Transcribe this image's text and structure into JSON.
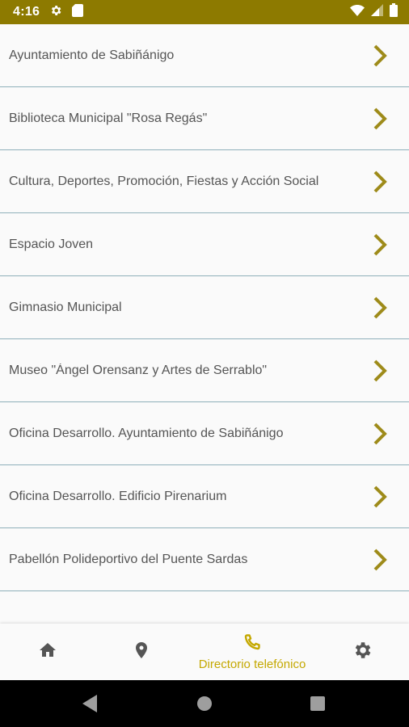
{
  "status_bar": {
    "time": "4:16",
    "icons": [
      "settings-icon",
      "sd-card-icon",
      "wifi-icon",
      "signal-icon",
      "battery-icon"
    ]
  },
  "directory": {
    "items": [
      {
        "label": "Ayuntamiento de Sabiñánigo"
      },
      {
        "label": "Biblioteca Municipal \"Rosa Regás\""
      },
      {
        "label": "Cultura, Deportes, Promoción, Fiestas y Acción Social"
      },
      {
        "label": "Espacio Joven"
      },
      {
        "label": "Gimnasio Municipal"
      },
      {
        "label": "Museo \"Ángel Orensanz y Artes de Serrablo\""
      },
      {
        "label": "Oficina Desarrollo. Ayuntamiento de Sabiñánigo"
      },
      {
        "label": "Oficina Desarrollo. Edificio Pirenarium"
      },
      {
        "label": "Pabellón Polideportivo del Puente Sardas"
      }
    ]
  },
  "bottom_nav": {
    "items": [
      {
        "icon": "home-icon",
        "label": ""
      },
      {
        "icon": "location-pin-icon",
        "label": ""
      },
      {
        "icon": "phone-icon",
        "label": "Directorio telefónico",
        "active": true
      },
      {
        "icon": "settings-icon",
        "label": ""
      }
    ]
  },
  "colors": {
    "status_bar": "#8d7a00",
    "accent": "#c4a800",
    "chevron": "#9e8b1a",
    "divider": "#8fb0ba",
    "nav_icon": "#555555"
  }
}
